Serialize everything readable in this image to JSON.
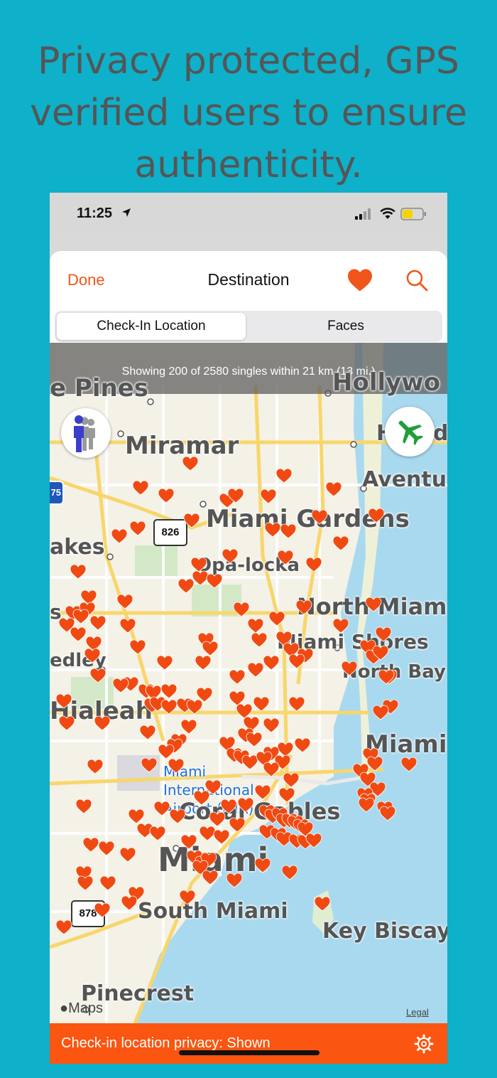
{
  "headline": {
    "line1": "Privacy protected, GPS",
    "line2": "verified users to ensure",
    "line3": "authenticity."
  },
  "status_bar": {
    "time": "11:25",
    "icons": [
      "location-arrow-icon",
      "signal-icon",
      "wifi-icon",
      "battery-icon"
    ]
  },
  "nav": {
    "done_label": "Done",
    "title": "Destination",
    "heart_icon": "heart-icon",
    "search_icon": "search-icon"
  },
  "segments": {
    "items": [
      {
        "label": "Check-In Location",
        "selected": true
      },
      {
        "label": "Faces",
        "selected": false
      }
    ]
  },
  "map": {
    "banner": "Showing 200 of 2580 singles within 21 km (13 mi.)",
    "places": {
      "pines": "e Pines",
      "hollywood": "Hollywo",
      "miramar": "Miramar",
      "hallandale": "Ha",
      "hallandale_end": "d",
      "aventura": "Aventu",
      "miami_gardens": "Miami Gardens",
      "oakes": "akes",
      "opa_locka": "Opa-locka",
      "north_miami": "North Miam",
      "miami_shores": "Miami Shores",
      "s_edge": "s",
      "hialeah_gardens": "edley",
      "north_bay": "North Bay",
      "hialeah": "Hialeah",
      "miami_beach": "Miami",
      "airport": "Miami\nInternational\nAirport (MIA)",
      "coral_gables": "Coral Gables",
      "miami": "Miami",
      "south_miami": "South Miami",
      "key_biscayne": "Key Biscay",
      "pinecrest": "Pinecrest",
      "hwy_826": "826",
      "hwy_878": "878",
      "hwy_75": "75"
    },
    "maps_label": "Maps",
    "legal_label": "Legal",
    "heart_color": "#f04a12",
    "people_icon": "people-icon",
    "plane_icon": "airplane-icon"
  },
  "footer": {
    "text": "Check-in location privacy: Shown",
    "gear_icon": "gear-icon",
    "accent": "#fa5511"
  }
}
